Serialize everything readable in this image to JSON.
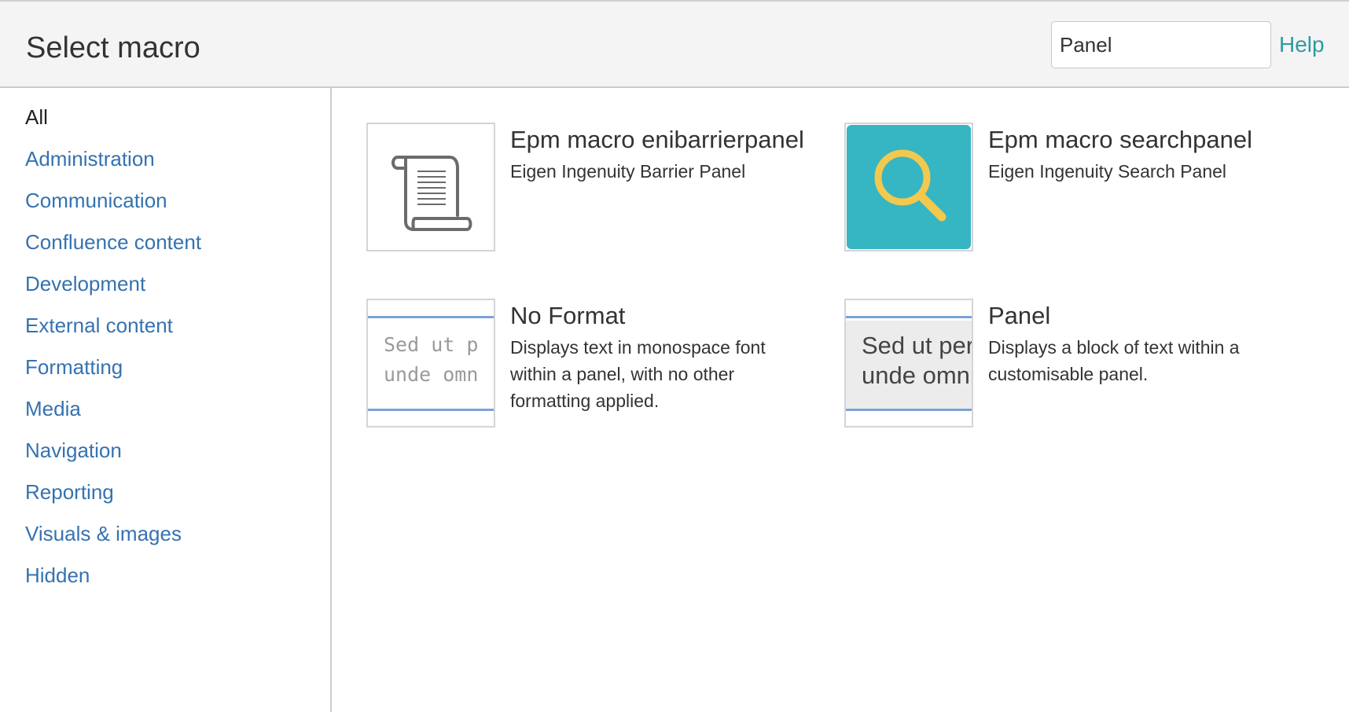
{
  "header": {
    "title": "Select macro",
    "search_value": "Panel",
    "help_label": "Help"
  },
  "sidebar": {
    "items": [
      {
        "label": "All",
        "active": true
      },
      {
        "label": "Administration"
      },
      {
        "label": "Communication"
      },
      {
        "label": "Confluence content"
      },
      {
        "label": "Development"
      },
      {
        "label": "External content"
      },
      {
        "label": "Formatting"
      },
      {
        "label": "Media"
      },
      {
        "label": "Navigation"
      },
      {
        "label": "Reporting"
      },
      {
        "label": "Visuals & images"
      },
      {
        "label": "Hidden"
      }
    ]
  },
  "macros": [
    {
      "title": "Epm macro enibarrierpanel",
      "description": "Eigen Ingenuity Barrier Panel",
      "icon": "scroll-icon"
    },
    {
      "title": "Epm macro searchpanel",
      "description": "Eigen Ingenuity Search Panel",
      "icon": "magnifier-icon"
    },
    {
      "title": "No Format",
      "description": "Displays text in monospace font within a panel, with no other formatting applied.",
      "preview_line1": "Sed ut p",
      "preview_line2": "unde omn"
    },
    {
      "title": "Panel",
      "description": "Displays a block of text within a customisable panel.",
      "preview_line1": "Sed ut per",
      "preview_line2": "unde omn"
    }
  ],
  "colors": {
    "link": "#3572b0",
    "help": "#2e9aa3",
    "search_tile": "#36b5c3",
    "magnifier": "#f2c94c",
    "panel_rule": "#7aa3d6"
  }
}
